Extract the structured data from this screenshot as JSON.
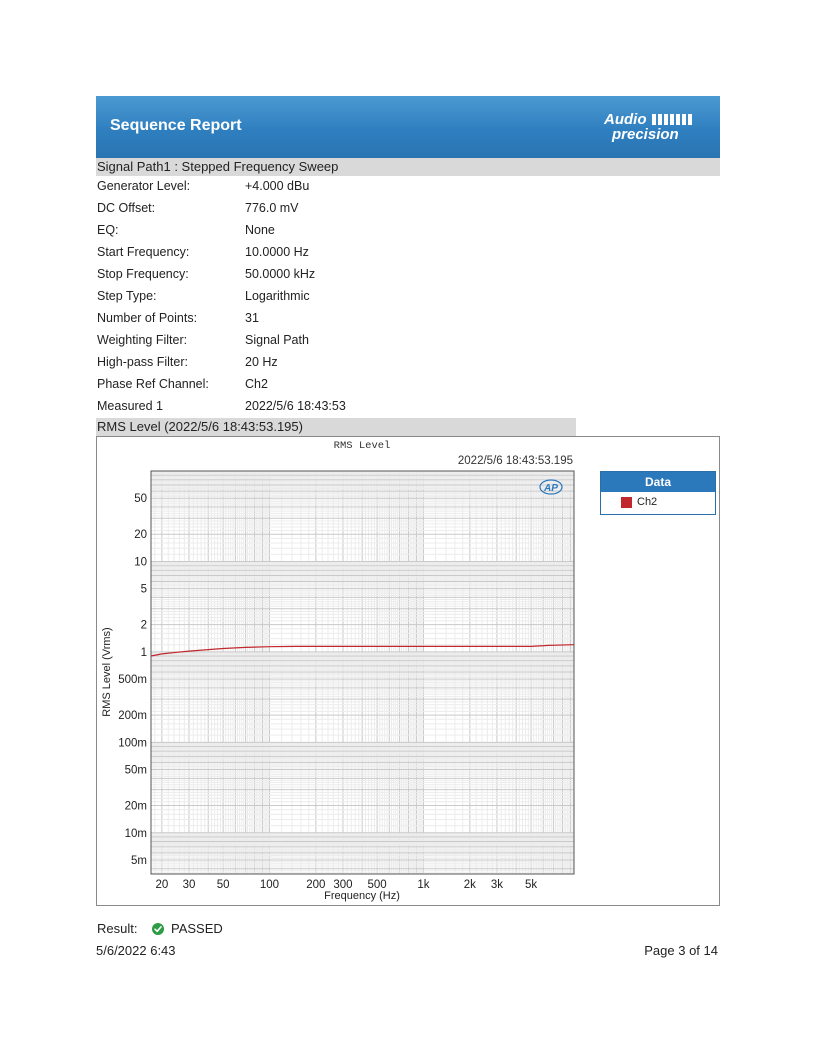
{
  "header": {
    "title": "Sequence Report",
    "logo_text_top": "Audio",
    "logo_text_bottom": "precision"
  },
  "section": {
    "title": "Signal Path1 : Stepped Frequency Sweep"
  },
  "parameters": [
    {
      "label": "Generator Level:",
      "value": "+4.000 dBu"
    },
    {
      "label": "DC Offset:",
      "value": "776.0 mV"
    },
    {
      "label": "EQ:",
      "value": "None"
    },
    {
      "label": "Start Frequency:",
      "value": "10.0000 Hz"
    },
    {
      "label": "Stop Frequency:",
      "value": "50.0000 kHz"
    },
    {
      "label": "Step Type:",
      "value": "Logarithmic"
    },
    {
      "label": "Number of Points:",
      "value": "31"
    },
    {
      "label": "Weighting Filter:",
      "value": "Signal Path"
    },
    {
      "label": "High-pass Filter:",
      "value": "20 Hz"
    },
    {
      "label": "Phase Ref Channel:",
      "value": "Ch2"
    },
    {
      "label": "Measured 1",
      "value": "2022/5/6 18:43:53"
    }
  ],
  "chart_section": {
    "title": "RMS Level (2022/5/6 18:43:53.195)"
  },
  "chart_data": {
    "type": "line",
    "title": "RMS Level",
    "timestamp": "2022/5/6 18:43:53.195",
    "xlabel": "Frequency (Hz)",
    "ylabel": "RMS Level (Vrms)",
    "x_scale": "log",
    "y_scale": "log",
    "xlim": [
      17,
      9500
    ],
    "ylim": [
      0.0035,
      100
    ],
    "x_ticks": [
      {
        "value": 20,
        "label": "20"
      },
      {
        "value": 30,
        "label": "30"
      },
      {
        "value": 50,
        "label": "50"
      },
      {
        "value": 100,
        "label": "100"
      },
      {
        "value": 200,
        "label": "200"
      },
      {
        "value": 300,
        "label": "300"
      },
      {
        "value": 500,
        "label": "500"
      },
      {
        "value": 1000,
        "label": "1k"
      },
      {
        "value": 2000,
        "label": "2k"
      },
      {
        "value": 3000,
        "label": "3k"
      },
      {
        "value": 5000,
        "label": "5k"
      }
    ],
    "y_ticks": [
      {
        "value": 50,
        "label": "50"
      },
      {
        "value": 20,
        "label": "20"
      },
      {
        "value": 10,
        "label": "10"
      },
      {
        "value": 5,
        "label": "5"
      },
      {
        "value": 2,
        "label": "2"
      },
      {
        "value": 1,
        "label": "1"
      },
      {
        "value": 0.5,
        "label": "500m"
      },
      {
        "value": 0.2,
        "label": "200m"
      },
      {
        "value": 0.1,
        "label": "100m"
      },
      {
        "value": 0.05,
        "label": "50m"
      },
      {
        "value": 0.02,
        "label": "20m"
      },
      {
        "value": 0.01,
        "label": "10m"
      },
      {
        "value": 0.005,
        "label": "5m"
      }
    ],
    "grid": true,
    "legend_title": "Data",
    "legend_position": "right",
    "series": [
      {
        "name": "Ch2",
        "color": "#c0282d",
        "x": [
          17,
          20,
          25,
          30,
          40,
          50,
          70,
          100,
          150,
          200,
          300,
          500,
          1000,
          2000,
          5000,
          6500,
          9500
        ],
        "y": [
          0.9,
          0.95,
          0.99,
          1.02,
          1.06,
          1.09,
          1.12,
          1.14,
          1.15,
          1.15,
          1.15,
          1.15,
          1.15,
          1.15,
          1.15,
          1.18,
          1.2
        ]
      }
    ]
  },
  "result": {
    "label": "Result:",
    "value": "PASSED",
    "status_color": "#2e9b45"
  },
  "footer": {
    "date": "5/6/2022 6:43",
    "page": "Page 3 of 14"
  }
}
